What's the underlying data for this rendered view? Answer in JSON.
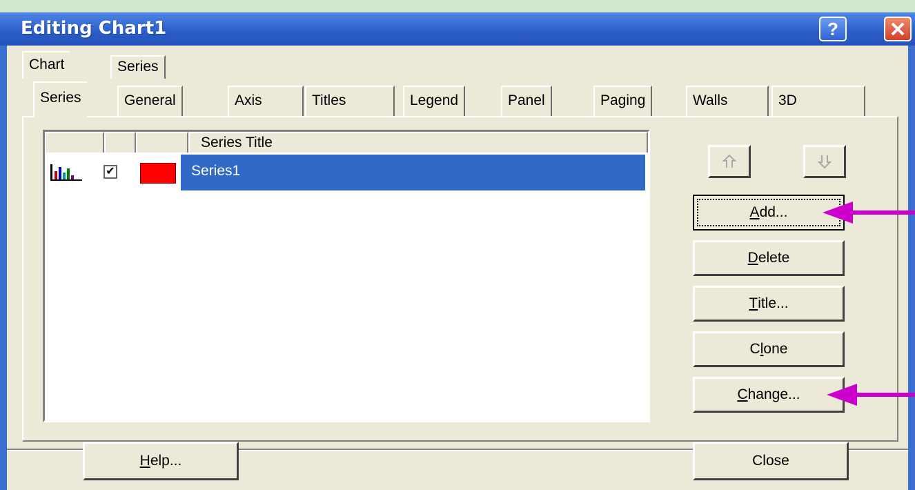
{
  "window": {
    "title": "Editing Chart1"
  },
  "outer_tabs": [
    "Chart",
    "Series"
  ],
  "inner_tabs": [
    "Series",
    "General",
    "Axis",
    "Titles",
    "Legend",
    "Panel",
    "Paging",
    "Walls",
    "3D"
  ],
  "series_list": {
    "header": "Series Title",
    "rows": [
      {
        "title": "Series1",
        "checked": true,
        "color": "#ff0000",
        "icon": "bar-chart-icon"
      }
    ]
  },
  "buttons": {
    "add": {
      "mnemonic": "A",
      "rest": "dd..."
    },
    "delete": {
      "mnemonic": "D",
      "rest": "elete"
    },
    "title": {
      "mnemonic": "T",
      "rest": "itle..."
    },
    "clone": {
      "pre": "C",
      "mnemonic": "l",
      "rest": "one"
    },
    "change": {
      "mnemonic": "C",
      "rest": "hange..."
    },
    "help": {
      "mnemonic": "H",
      "rest": "elp..."
    },
    "close": "Close"
  },
  "colors": {
    "titlebar": "#2a5cc6",
    "selection": "#3169c6",
    "annotation_arrow": "#cc00cc"
  }
}
